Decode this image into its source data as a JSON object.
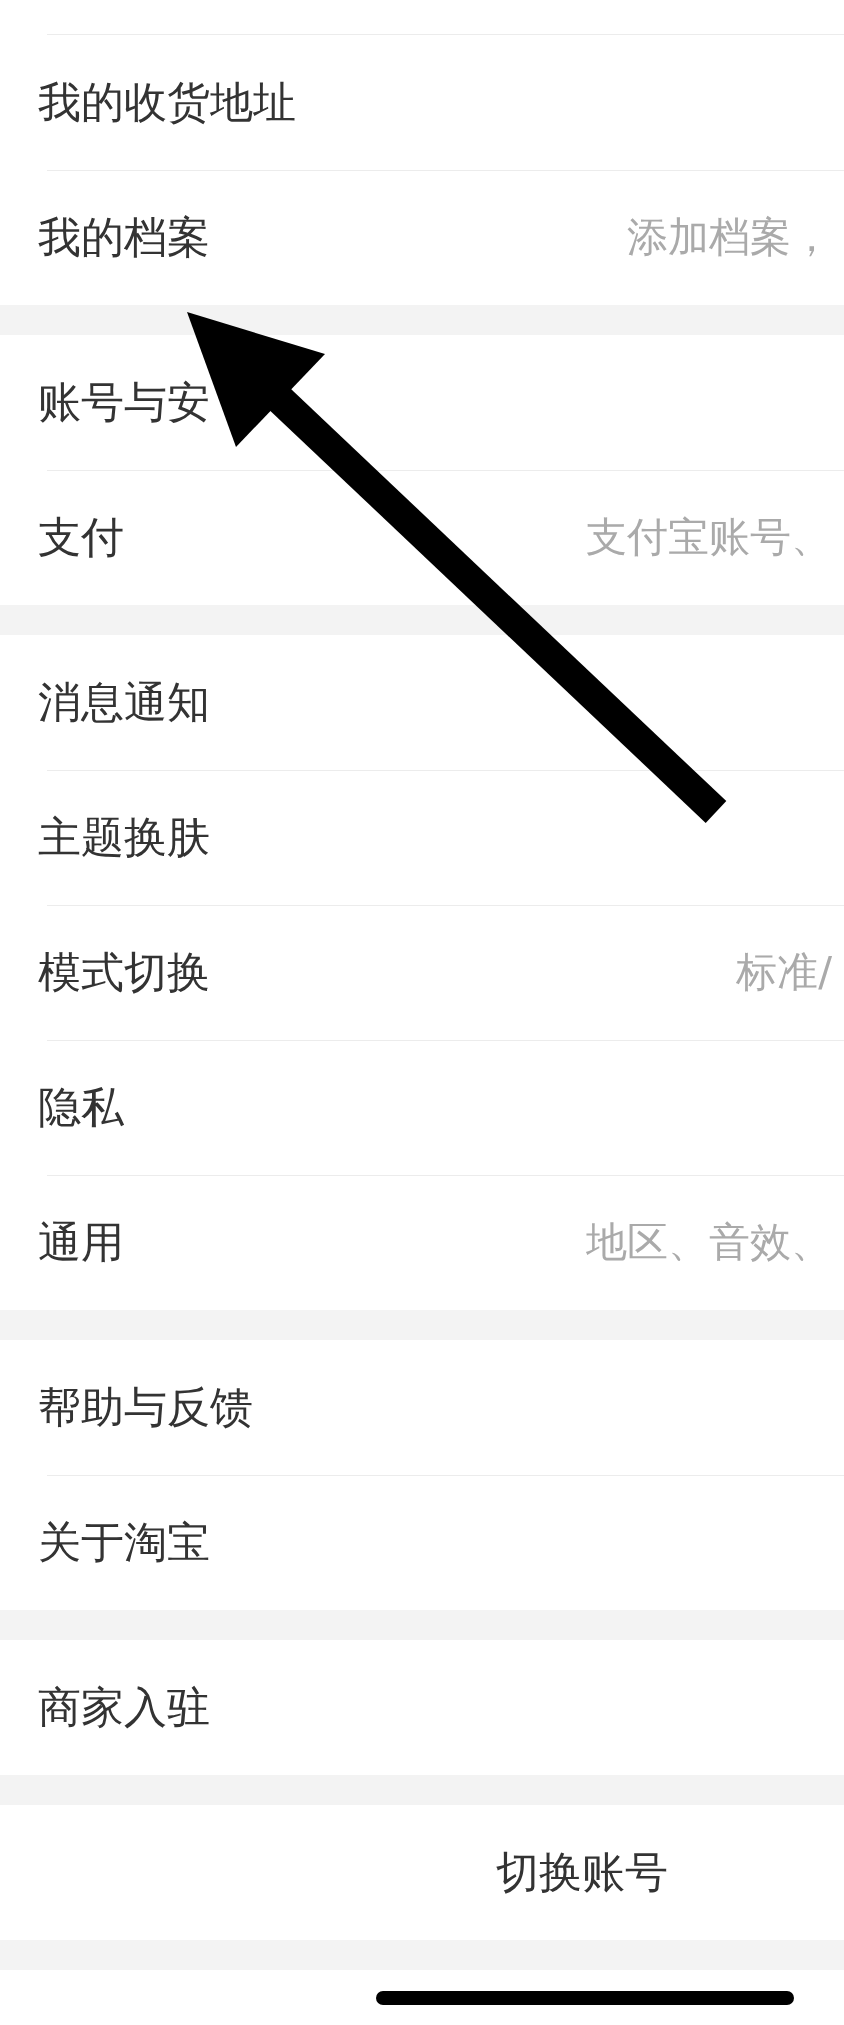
{
  "groups": [
    {
      "items": [
        {
          "label": "我的收货地址"
        },
        {
          "label": "我的档案",
          "hint": "添加档案，"
        }
      ]
    },
    {
      "items": [
        {
          "label": "账号与安"
        },
        {
          "label": "支付",
          "hint": "支付宝账号、"
        }
      ]
    },
    {
      "items": [
        {
          "label": "消息通知"
        },
        {
          "label": "主题换肤"
        },
        {
          "label": "模式切换",
          "hint": "标准/"
        },
        {
          "label": "隐私"
        },
        {
          "label": "通用",
          "hint": "地区、音效、"
        }
      ]
    },
    {
      "items": [
        {
          "label": "帮助与反馈"
        },
        {
          "label": "关于淘宝"
        }
      ]
    },
    {
      "items": [
        {
          "label": "商家入驻"
        }
      ]
    }
  ],
  "buttons": [
    {
      "label": "切换账号"
    }
  ]
}
